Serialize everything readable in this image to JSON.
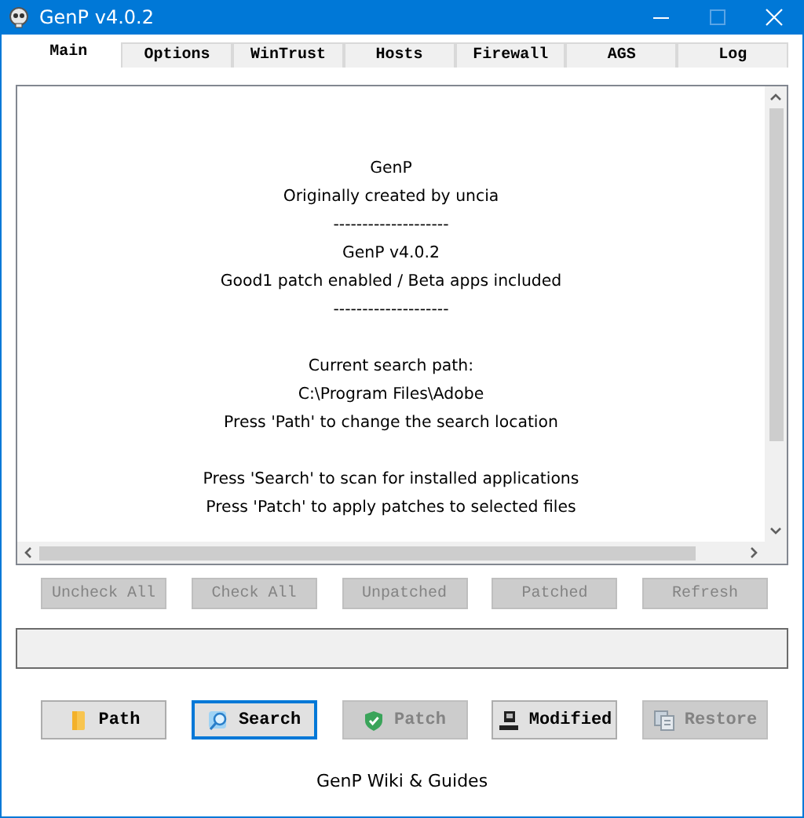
{
  "window": {
    "title": "GenP v4.0.2"
  },
  "tabs": [
    {
      "label": "Main",
      "selected": true
    },
    {
      "label": "Options",
      "selected": false
    },
    {
      "label": "WinTrust",
      "selected": false
    },
    {
      "label": "Hosts",
      "selected": false
    },
    {
      "label": "Firewall",
      "selected": false
    },
    {
      "label": "AGS",
      "selected": false
    },
    {
      "label": "Log",
      "selected": false
    }
  ],
  "output": {
    "paragraphs": [
      [
        "GenP",
        "Originally created by uncia",
        "--------------------",
        "GenP v4.0.2",
        "Good1 patch enabled / Beta apps included",
        "--------------------"
      ],
      [
        "Current search path:",
        "C:\\Program Files\\Adobe",
        "Press 'Path' to change the search location"
      ],
      [
        "Press 'Search' to scan for installed applications",
        "Press 'Patch' to apply patches to selected files"
      ]
    ]
  },
  "filter_buttons": [
    {
      "label": "Uncheck All",
      "disabled": true
    },
    {
      "label": "Check All",
      "disabled": true
    },
    {
      "label": "Unpatched",
      "disabled": true
    },
    {
      "label": "Patched",
      "disabled": true
    },
    {
      "label": "Refresh",
      "disabled": true
    }
  ],
  "action_buttons": [
    {
      "label": "Path",
      "kind": "folder",
      "disabled": false,
      "focused": false
    },
    {
      "label": "Search",
      "kind": "search",
      "disabled": false,
      "focused": true
    },
    {
      "label": "Patch",
      "kind": "shield",
      "disabled": true,
      "focused": false
    },
    {
      "label": "Modified",
      "kind": "computer",
      "disabled": false,
      "focused": false
    },
    {
      "label": "Restore",
      "kind": "restore",
      "disabled": true,
      "focused": false
    }
  ],
  "link": "GenP Wiki & Guides"
}
